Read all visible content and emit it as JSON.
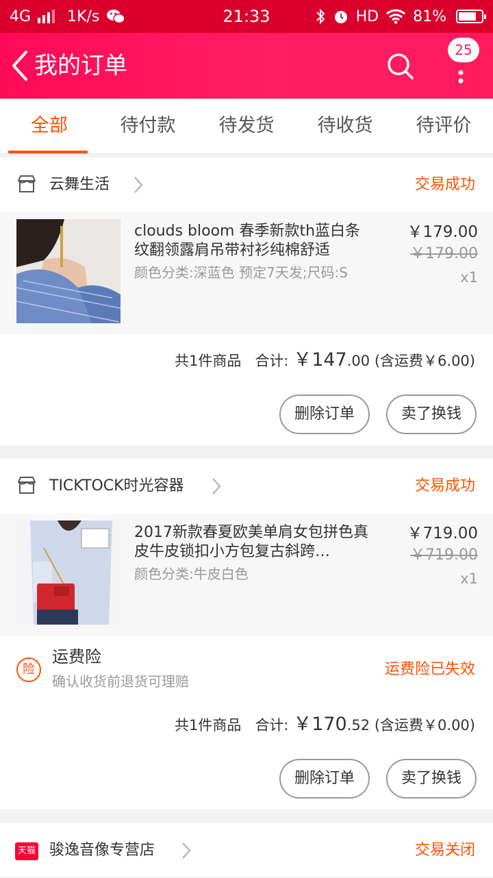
{
  "status_bar": {
    "network": "4G",
    "speed": "1K/s",
    "time": "21:33",
    "hd": "HD",
    "battery": "81%"
  },
  "header": {
    "title": "我的订单",
    "badge": "25"
  },
  "tabs": [
    "全部",
    "待付款",
    "待发货",
    "待收货",
    "待评价"
  ],
  "orders": [
    {
      "shop": "云舞生活",
      "status": "交易成功",
      "item_title": "clouds bloom 春季新款th蓝白条纹翻领露肩吊带衬衫纯棉舒适",
      "sku": "颜色分类:深蓝色  预定7天发;尺码:S",
      "price": "￥179.00",
      "original_price": "￥179.00",
      "qty": "x1",
      "count_text": "共1件商品",
      "total_label": "合计:",
      "total_int": "￥147",
      "total_dec": ".00",
      "shipping": "(含运费￥6.00)",
      "btn_delete": "删除订单",
      "btn_sell": "卖了换钱"
    },
    {
      "shop": "TICKTOCK时光容器",
      "status": "交易成功",
      "item_title": "2017新款春夏欧美单肩女包拼色真皮牛皮锁扣小方包复古斜跨…",
      "sku": "颜色分类:牛皮白色",
      "price": "￥719.00",
      "original_price": "￥719.00",
      "qty": "x1",
      "insurance_icon": "险",
      "insurance_title": "运费险",
      "insurance_desc": "确认收货前退货可理赔",
      "insurance_status": "运费险已失效",
      "count_text": "共1件商品",
      "total_label": "合计:",
      "total_int": "￥170",
      "total_dec": ".52",
      "shipping": "(含运费￥0.00)",
      "btn_delete": "删除订单",
      "btn_sell": "卖了换钱"
    },
    {
      "shop": "骏逸音像专营店",
      "shop_badge": "天猫",
      "status": "交易关闭"
    }
  ],
  "colors": {
    "accent": "#ff5000",
    "header": "#ff1d5c",
    "status_bar": "#d9002d"
  }
}
